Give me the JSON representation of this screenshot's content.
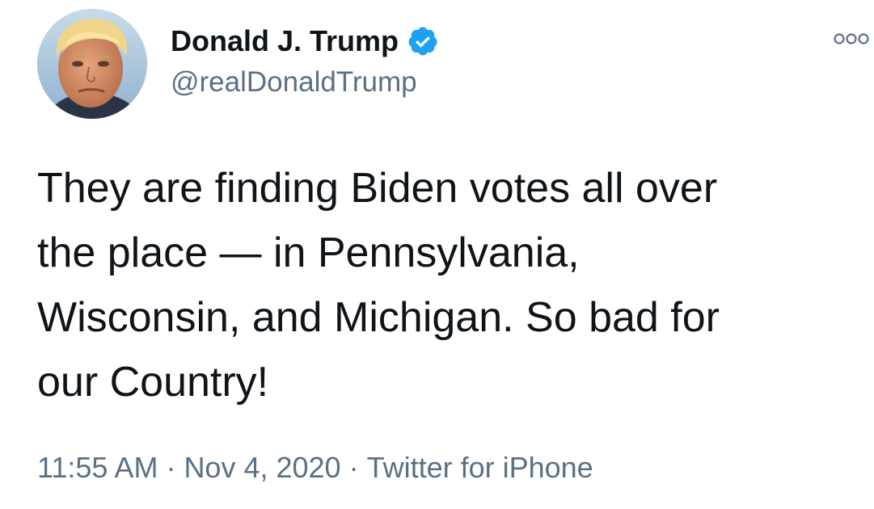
{
  "author": {
    "display_name": "Donald J. Trump",
    "handle": "@realDonaldTrump",
    "verified": true
  },
  "tweet": {
    "lines": [
      "They are finding Biden votes all over",
      "the place — in Pennsylvania,",
      "Wisconsin, and Michigan. So bad for",
      "our Country!"
    ],
    "time": "11:55 AM",
    "separator": "·",
    "date": "Nov 4, 2020",
    "source": "Twitter for iPhone"
  },
  "colors": {
    "verified_badge": "#1da1f2",
    "secondary_text": "#5b7083",
    "primary_text": "#0f1419"
  },
  "icons": {
    "verified": "verified-badge-icon",
    "more": "more-options-icon"
  }
}
